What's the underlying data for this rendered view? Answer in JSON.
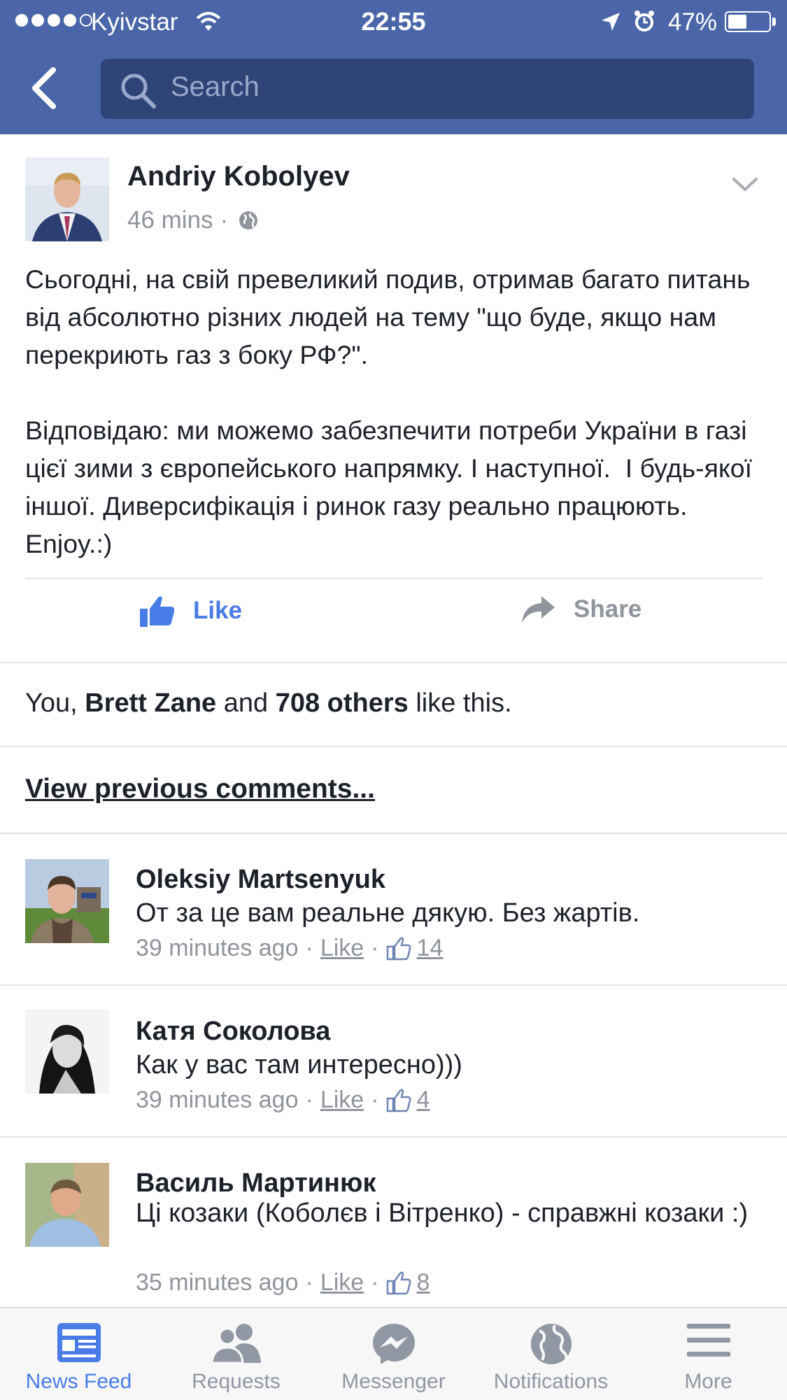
{
  "status_bar": {
    "carrier": "Kyivstar",
    "time": "22:55",
    "battery_percent": "47%",
    "battery_level": 0.47
  },
  "header": {
    "search_placeholder": "Search"
  },
  "post": {
    "author": "Andriy Kobolyev",
    "time": "46 mins",
    "separator": "·",
    "text": "Сьогодні, на свій превеликий подив, отримав багато питань від абсолютно різних людей на тему \"що буде, якщо нам перекриють газ з боку РФ?\".\n\nВідповідаю: ми можемо забезпечити потреби України в газі цієї зими з європейського напрямку. І наступної.  І будь-якої іншої. Диверсифікація і ринок газу реально працюють. Enjoy.:)",
    "like_label": "Like",
    "share_label": "Share"
  },
  "likes_summary": {
    "prefix": "You, ",
    "name": "Brett Zane",
    "middle": " and ",
    "others": "708 others",
    "suffix": " like this."
  },
  "view_previous": "View previous comments...",
  "comments": [
    {
      "name": "Oleksiy Martsenyuk",
      "text": "От за це вам реальне дякую. Без жартів.",
      "time": "39 minutes ago",
      "like_label": "Like",
      "like_count": "14"
    },
    {
      "name": "Катя Соколова",
      "text": "Как у вас там интересно)))",
      "time": "39 minutes ago",
      "like_label": "Like",
      "like_count": "4"
    },
    {
      "name": "Василь Мартинюк",
      "text": "Ці козаки (Коболєв і Вітренко) - справжні козаки :)",
      "time": "35 minutes ago",
      "like_label": "Like",
      "like_count": "8"
    }
  ],
  "tab_bar": {
    "tabs": [
      {
        "label": "News Feed",
        "icon": "news-feed-icon",
        "active": true
      },
      {
        "label": "Requests",
        "icon": "friend-requests-icon",
        "active": false
      },
      {
        "label": "Messenger",
        "icon": "messenger-icon",
        "active": false
      },
      {
        "label": "Notifications",
        "icon": "globe-icon",
        "active": false
      },
      {
        "label": "More",
        "icon": "menu-icon",
        "active": false
      }
    ]
  },
  "colors": {
    "header_blue": "#4a66a8",
    "search_field": "#2e4477",
    "accent_blue": "#4a7ce8",
    "muted_gray": "#90949c"
  }
}
